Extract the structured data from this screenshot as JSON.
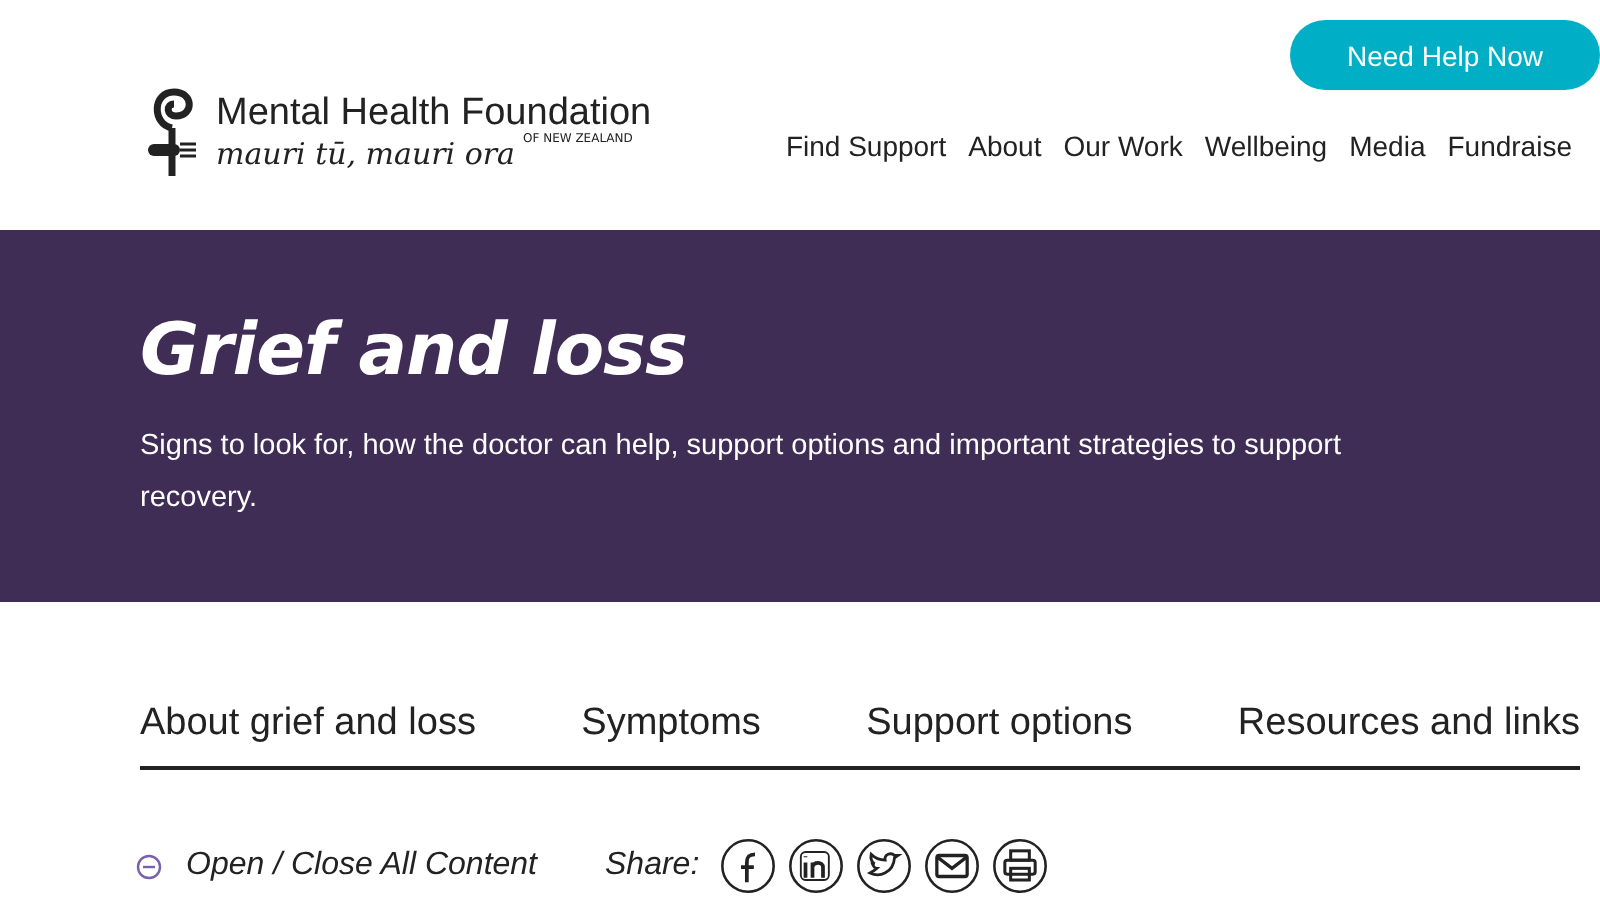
{
  "header": {
    "logo": {
      "name": "Mental Health Foundation",
      "tagline": "mauri tū, mauri ora",
      "country": "OF NEW ZEALAND"
    },
    "help_button": "Need Help Now",
    "nav": [
      "Find Support",
      "About",
      "Our Work",
      "Wellbeing",
      "Media",
      "Fundraise"
    ]
  },
  "banner": {
    "title": "Grief and loss",
    "text": "Signs to look for, how the doctor can help, support options and important strategies to support recovery."
  },
  "tabs": [
    "About grief and loss",
    "Symptoms",
    "Support options",
    "Resources and links"
  ],
  "toolbar": {
    "toggle": "Open / Close All Content",
    "share_label": "Share:",
    "share": [
      {
        "kind": "facebook"
      },
      {
        "kind": "linkedin"
      },
      {
        "kind": "twitter"
      },
      {
        "kind": "email"
      },
      {
        "kind": "print"
      }
    ]
  }
}
